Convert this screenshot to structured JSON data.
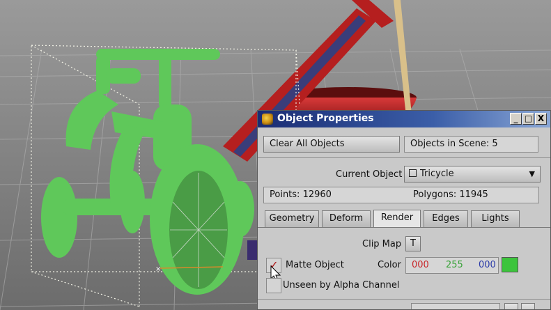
{
  "window": {
    "title": "Object Properties",
    "minimize": "_",
    "maximize": "□",
    "close": "X"
  },
  "toolbar": {
    "clear_all": "Clear All Objects",
    "objects_in_scene": "Objects in Scene: 5"
  },
  "current_object": {
    "label": "Current Object",
    "value": "Tricycle",
    "chevron": "▼"
  },
  "stats": {
    "points": "Points: 12960",
    "polygons": "Polygons: 11945"
  },
  "tabs": [
    {
      "label": "Geometry",
      "active": false
    },
    {
      "label": "Deform",
      "active": false
    },
    {
      "label": "Render",
      "active": true
    },
    {
      "label": "Edges",
      "active": false
    },
    {
      "label": "Lights",
      "active": false
    }
  ],
  "render": {
    "clip_map_label": "Clip Map",
    "clip_map_button": "T",
    "matte_object_label": "Matte Object",
    "matte_checked": true,
    "check_mark": "✓",
    "color_label": "Color",
    "color_r": "000",
    "color_g": "255",
    "color_b": "000",
    "color_swatch": "#3cc43c",
    "unseen_alpha_label": "Unseen by Alpha Channel"
  },
  "colors": {
    "title_bar": "#1a2c73",
    "panel_bg": "#c9c9c9",
    "tricycle_green": "#5fc85a",
    "red_object": "#b51f1f"
  }
}
